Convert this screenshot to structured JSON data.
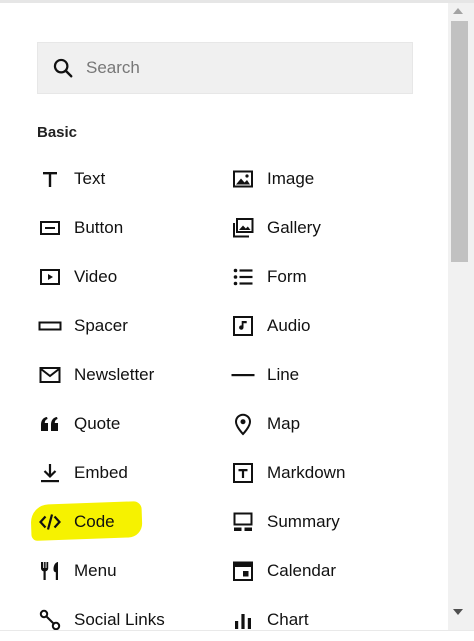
{
  "search": {
    "placeholder": "Search"
  },
  "section": {
    "title": "Basic"
  },
  "blocks": [
    {
      "label": "Text",
      "icon": "text-icon"
    },
    {
      "label": "Image",
      "icon": "image-icon"
    },
    {
      "label": "Button",
      "icon": "button-icon"
    },
    {
      "label": "Gallery",
      "icon": "gallery-icon"
    },
    {
      "label": "Video",
      "icon": "video-icon"
    },
    {
      "label": "Form",
      "icon": "form-icon"
    },
    {
      "label": "Spacer",
      "icon": "spacer-icon"
    },
    {
      "label": "Audio",
      "icon": "audio-icon"
    },
    {
      "label": "Newsletter",
      "icon": "mail-icon"
    },
    {
      "label": "Line",
      "icon": "line-icon"
    },
    {
      "label": "Quote",
      "icon": "quote-icon"
    },
    {
      "label": "Map",
      "icon": "map-pin-icon"
    },
    {
      "label": "Embed",
      "icon": "embed-icon"
    },
    {
      "label": "Markdown",
      "icon": "markdown-icon"
    },
    {
      "label": "Code",
      "icon": "code-icon"
    },
    {
      "label": "Summary",
      "icon": "summary-icon"
    },
    {
      "label": "Menu",
      "icon": "menu-icon"
    },
    {
      "label": "Calendar",
      "icon": "calendar-icon"
    },
    {
      "label": "Social Links",
      "icon": "social-links-icon"
    },
    {
      "label": "Chart",
      "icon": "chart-icon"
    }
  ],
  "highlight_color": "#f6f200"
}
